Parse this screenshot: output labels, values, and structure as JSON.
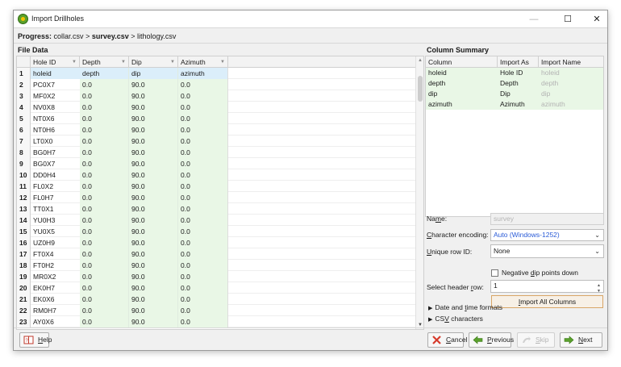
{
  "window": {
    "title": "Import Drillholes",
    "min_icon": "—",
    "max_icon": "☐",
    "close_icon": "✕"
  },
  "progress": {
    "label": "Progress:",
    "step1": "collar.csv",
    "sep1": ">",
    "step2": "survey.csv",
    "sep2": ">",
    "step3": "lithology.csv"
  },
  "file_data": {
    "title": "File Data",
    "columns": [
      "Hole ID",
      "Depth",
      "Dip",
      "Azimuth"
    ],
    "rows": [
      {
        "n": "1",
        "hole": "holeid",
        "depth": "depth",
        "dip": "dip",
        "az": "azimuth"
      },
      {
        "n": "2",
        "hole": "PC0X7",
        "depth": "0.0",
        "dip": "90.0",
        "az": "0.0"
      },
      {
        "n": "3",
        "hole": "MF0X2",
        "depth": "0.0",
        "dip": "90.0",
        "az": "0.0"
      },
      {
        "n": "4",
        "hole": "NV0X8",
        "depth": "0.0",
        "dip": "90.0",
        "az": "0.0"
      },
      {
        "n": "5",
        "hole": "NT0X6",
        "depth": "0.0",
        "dip": "90.0",
        "az": "0.0"
      },
      {
        "n": "6",
        "hole": "NT0H6",
        "depth": "0.0",
        "dip": "90.0",
        "az": "0.0"
      },
      {
        "n": "7",
        "hole": "LT0X0",
        "depth": "0.0",
        "dip": "90.0",
        "az": "0.0"
      },
      {
        "n": "8",
        "hole": "BG0H7",
        "depth": "0.0",
        "dip": "90.0",
        "az": "0.0"
      },
      {
        "n": "9",
        "hole": "BG0X7",
        "depth": "0.0",
        "dip": "90.0",
        "az": "0.0"
      },
      {
        "n": "10",
        "hole": "DD0H4",
        "depth": "0.0",
        "dip": "90.0",
        "az": "0.0"
      },
      {
        "n": "11",
        "hole": "FL0X2",
        "depth": "0.0",
        "dip": "90.0",
        "az": "0.0"
      },
      {
        "n": "12",
        "hole": "FL0H7",
        "depth": "0.0",
        "dip": "90.0",
        "az": "0.0"
      },
      {
        "n": "13",
        "hole": "TT0X1",
        "depth": "0.0",
        "dip": "90.0",
        "az": "0.0"
      },
      {
        "n": "14",
        "hole": "YU0H3",
        "depth": "0.0",
        "dip": "90.0",
        "az": "0.0"
      },
      {
        "n": "15",
        "hole": "YU0X5",
        "depth": "0.0",
        "dip": "90.0",
        "az": "0.0"
      },
      {
        "n": "16",
        "hole": "UZ0H9",
        "depth": "0.0",
        "dip": "90.0",
        "az": "0.0"
      },
      {
        "n": "17",
        "hole": "FT0X4",
        "depth": "0.0",
        "dip": "90.0",
        "az": "0.0"
      },
      {
        "n": "18",
        "hole": "FT0H2",
        "depth": "0.0",
        "dip": "90.0",
        "az": "0.0"
      },
      {
        "n": "19",
        "hole": "MR0X2",
        "depth": "0.0",
        "dip": "90.0",
        "az": "0.0"
      },
      {
        "n": "20",
        "hole": "EK0H7",
        "depth": "0.0",
        "dip": "90.0",
        "az": "0.0"
      },
      {
        "n": "21",
        "hole": "EK0X6",
        "depth": "0.0",
        "dip": "90.0",
        "az": "0.0"
      },
      {
        "n": "22",
        "hole": "RM0H7",
        "depth": "0.0",
        "dip": "90.0",
        "az": "0.0"
      },
      {
        "n": "23",
        "hole": "AY0X6",
        "depth": "0.0",
        "dip": "90.0",
        "az": "0.0"
      }
    ]
  },
  "summary": {
    "title": "Column Summary",
    "headers": [
      "Column",
      "Import As",
      "Import Name"
    ],
    "rows": [
      {
        "column": "holeid",
        "import_as": "Hole ID",
        "import_name": "holeid"
      },
      {
        "column": "depth",
        "import_as": "Depth",
        "import_name": "depth"
      },
      {
        "column": "dip",
        "import_as": "Dip",
        "import_name": "dip"
      },
      {
        "column": "azimuth",
        "import_as": "Azimuth",
        "import_name": "azimuth"
      }
    ]
  },
  "form": {
    "name_label_pre": "Na",
    "name_label_u": "m",
    "name_label_post": "e:",
    "name_value": "survey",
    "encoding_label_pre": "",
    "encoding_label_u": "C",
    "encoding_label_post": "haracter encoding:",
    "encoding_value": "Auto (Windows-1252)",
    "unique_label_pre": "",
    "unique_label_u": "U",
    "unique_label_post": "nique row ID:",
    "unique_value": "None",
    "negative_dip_pre": "Negative ",
    "negative_dip_u": "d",
    "negative_dip_post": "ip points down",
    "header_row_label_pre": "Select header ",
    "header_row_label_u": "r",
    "header_row_label_post": "ow:",
    "header_row_value": "1",
    "import_all_pre": "",
    "import_all_u": "I",
    "import_all_post": "mport All Columns",
    "date_formats_pre": "Date and ",
    "date_formats_u": "t",
    "date_formats_post": "ime formats",
    "csv_chars_pre": "CS",
    "csv_chars_u": "V",
    "csv_chars_post": " characters"
  },
  "buttons": {
    "help_u": "H",
    "help_post": "elp",
    "cancel_u": "C",
    "cancel_post": "ancel",
    "previous_u": "P",
    "previous_post": "revious",
    "skip_u": "S",
    "skip_post": "kip",
    "next_u": "N",
    "next_post": "ext"
  },
  "colors": {
    "mapped_column_bg": "#e9f7e6",
    "selected_row_bg": "#dbeefa",
    "encoding_text": "#2a5bd7",
    "import_all_border": "#d9a566"
  }
}
